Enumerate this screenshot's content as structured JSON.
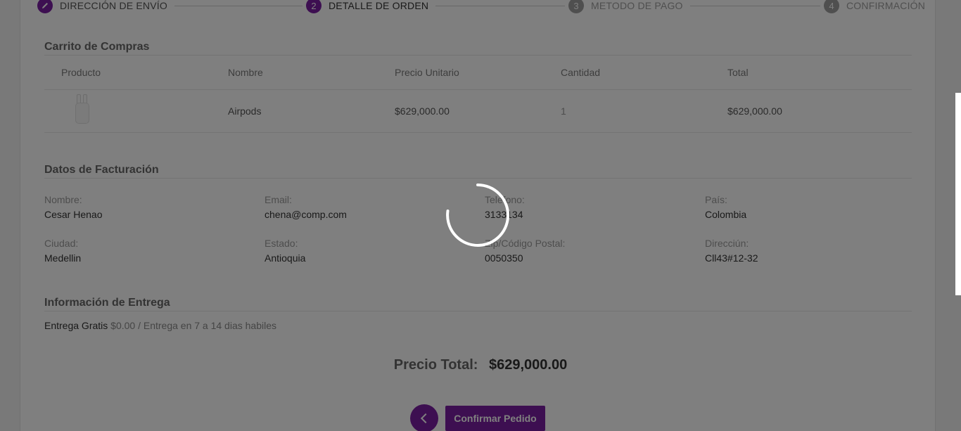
{
  "stepper": {
    "steps": [
      {
        "number": "",
        "label": "DIRECCIÓN DE ENVÍO",
        "state": "done",
        "icon": "pencil-icon"
      },
      {
        "number": "2",
        "label": "DETALLE DE ORDEN",
        "state": "active"
      },
      {
        "number": "3",
        "label": "METODO DE PAGO",
        "state": "pending"
      },
      {
        "number": "4",
        "label": "CONFIRMACIÓN",
        "state": "pending"
      }
    ]
  },
  "cart": {
    "title": "Carrito de Compras",
    "headers": [
      "Producto",
      "Nombre",
      "Precio Unitario",
      "Cantidad",
      "Total"
    ],
    "rows": [
      {
        "image": "airpods-image",
        "name": "Airpods",
        "unit_price": "$629,000.00",
        "quantity": "1",
        "total": "$629,000.00"
      }
    ]
  },
  "billing": {
    "title": "Datos de Facturación",
    "fields": [
      {
        "label": "Nombre:",
        "value": "Cesar Henao"
      },
      {
        "label": "Email:",
        "value": "chena@comp.com"
      },
      {
        "label": "Telefono:",
        "value": "3133134"
      },
      {
        "label": "País:",
        "value": "Colombia"
      },
      {
        "label": "Ciudad:",
        "value": "Medellin"
      },
      {
        "label": "Estado:",
        "value": "Antioquia"
      },
      {
        "label": "Zip/Código Postal:",
        "value": "0050350"
      },
      {
        "label": "Direcciún:",
        "value": "Cll43#12-32"
      }
    ]
  },
  "delivery": {
    "title": "Información de Entrega",
    "method": "Entrega Gratis",
    "details": "$0.00 / Entrega en 7 a 14 dias habiles"
  },
  "total": {
    "label": "Precio Total:",
    "value": "$629,000.00"
  },
  "actions": {
    "back_icon": "chevron-left-icon",
    "confirm_label": "Confirmar Pedido"
  },
  "colors": {
    "accent": "#7b1fa2",
    "overlay": "rgba(0,0,0,0.5)"
  },
  "loading": true
}
